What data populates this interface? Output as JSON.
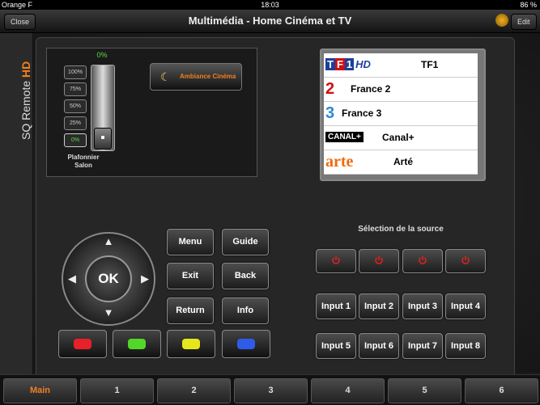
{
  "status": {
    "carrier": "Orange F",
    "time": "18:03",
    "battery": "86 %"
  },
  "nav": {
    "title": "Multimédia - Home Cinéma et TV",
    "close_label": "Close",
    "edit_label": "Edit"
  },
  "brand": {
    "name": "SQ Remote",
    "suffix": "HD"
  },
  "light": {
    "percent_label": "0%",
    "levels": [
      "100%",
      "75%",
      "50%",
      "25%",
      "0%"
    ],
    "active_level": "0%",
    "name_line1": "Plafonnier",
    "name_line2": "Salon",
    "slider_value": 0
  },
  "ambiance_label": "Ambiance Cinéma",
  "channels": [
    {
      "logo": "TF1 HD",
      "name": "TF1"
    },
    {
      "logo": "2 HD",
      "name": "France 2"
    },
    {
      "logo": "3",
      "name": "France 3"
    },
    {
      "logo": "CANAL+",
      "name": "Canal+"
    },
    {
      "logo": "arte",
      "name": "Arté"
    }
  ],
  "menu_buttons": {
    "menu": "Menu",
    "guide": "Guide",
    "exit": "Exit",
    "back": "Back",
    "return": "Return",
    "info": "Info"
  },
  "dpad": {
    "ok_label": "OK"
  },
  "color_buttons": [
    "#e8202a",
    "#52d62a",
    "#e6e61c",
    "#2f5be8"
  ],
  "source": {
    "title": "Sélection de la source",
    "inputs": [
      "Input 1",
      "Input 2",
      "Input 3",
      "Input 4",
      "Input 5",
      "Input 6",
      "Input 7",
      "Input 8"
    ]
  },
  "tabs": [
    "Main",
    "1",
    "2",
    "3",
    "4",
    "5",
    "6"
  ],
  "colors": {
    "accent": "#f08020",
    "active_green": "#5ade42",
    "power_red": "#e02020"
  }
}
